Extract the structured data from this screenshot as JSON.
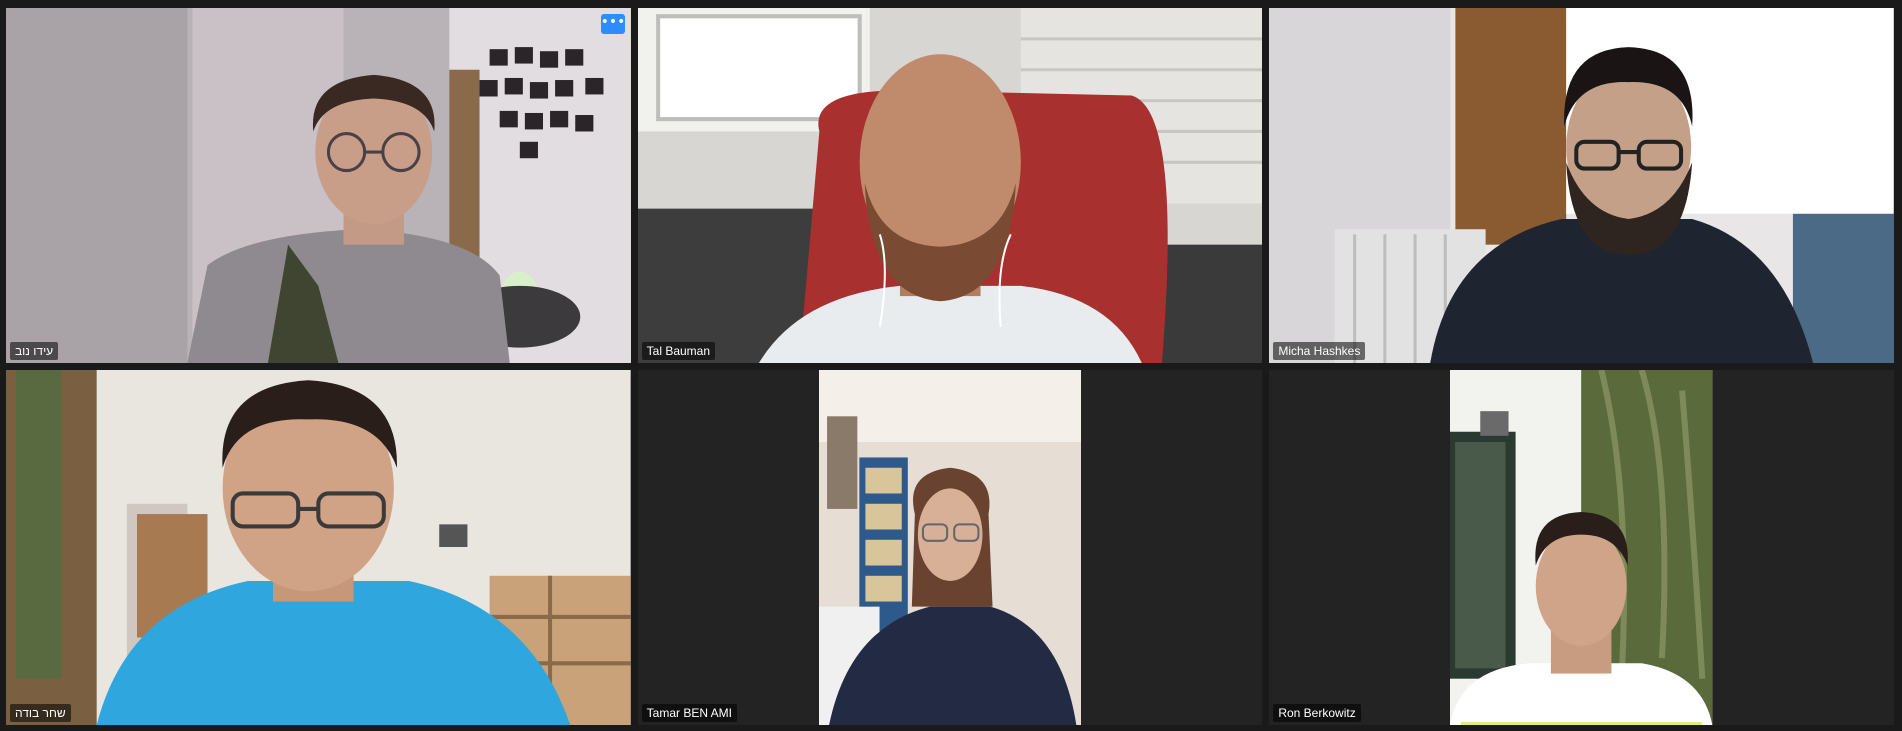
{
  "meeting": {
    "participants": [
      {
        "name": "עידו נוב",
        "active_speaker": true
      },
      {
        "name": "Tal Bauman"
      },
      {
        "name": "Micha Hashkes"
      },
      {
        "name": "שחר בודה"
      },
      {
        "name": "Tamar BEN AMI"
      },
      {
        "name": "Ron Berkowitz"
      }
    ],
    "more_button_label": "•••"
  },
  "colors": {
    "active_border": "#e4ea7a",
    "more_button": "#2d8cff",
    "background": "#1a1a1a"
  }
}
